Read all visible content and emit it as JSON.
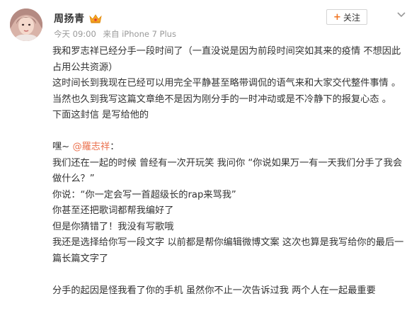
{
  "post": {
    "author": {
      "name": "周扬青",
      "avatar": "avatar-image",
      "badge": "crown-badge-icon"
    },
    "meta": {
      "time": "今天 09:00",
      "source": "来自 iPhone 7 Plus"
    },
    "follow_button": {
      "plus": "+",
      "label": "关注"
    },
    "menu_icon": "chevron-down-icon",
    "paragraphs": {
      "p1": "我和罗志祥已经分手一段时间了（一直没说是因为前段时间突如其来的疫情 不想因此占用公共资源）",
      "p2": "这时间长到我现在已经可以用完全平静甚至略带调侃的语气来和大家交代整件事情 。当然也久到我写这篇文章绝不是因为刚分手的一时冲动或是不冷静下的报复心态 。",
      "p3": "下面这封信 是写给他的",
      "p4_prefix": "嘿~ ",
      "p4_mention": "@羅志祥",
      "p4_suffix": "：",
      "p5": "我们还在一起的时候 曾经有一次开玩笑 我问你 “你说如果万一有一天我们分手了我会做什么？”",
      "p6": "你说：“你一定会写一首超级长的rap来骂我”",
      "p7": "你甚至还把歌词都帮我编好了",
      "p8": "但是你猜错了！我没有写歌哦",
      "p9": "我还是选择给你写一段文字  以前都是帮你编辑微博文案 这次也算是我写给你的最后一篇长篇文字了",
      "p10": "分手的起因是怪我看了你的手机  虽然你不止一次告诉过我  两个人在一起最重要"
    },
    "colors": {
      "mention": "#eb7350",
      "follow_plus": "#f0731f",
      "meta_text": "#999999"
    }
  }
}
